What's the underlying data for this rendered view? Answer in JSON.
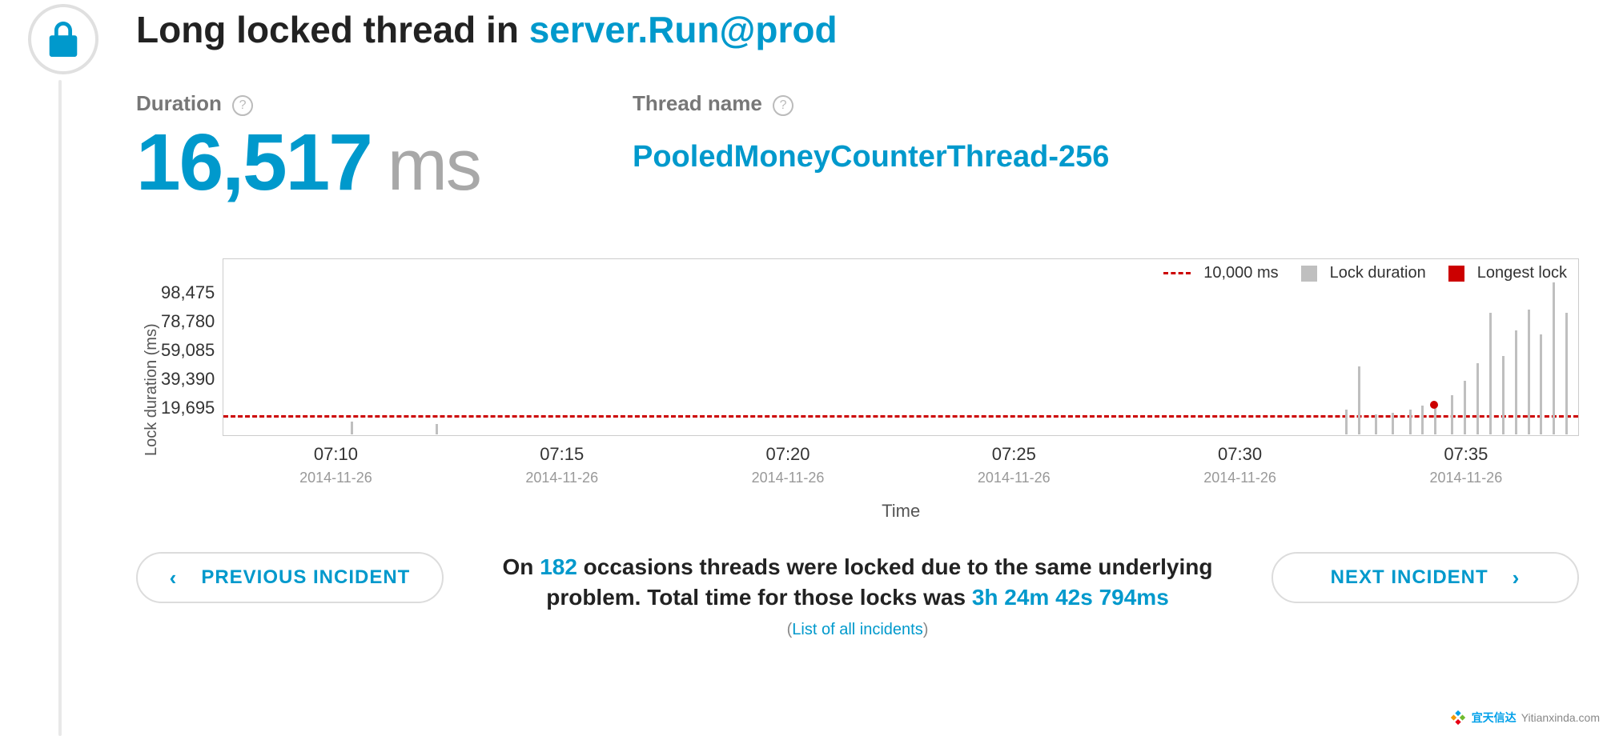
{
  "title_prefix": "Long locked thread in ",
  "title_accent": "server.Run@prod",
  "duration": {
    "label": "Duration",
    "value": "16,517",
    "unit": "ms"
  },
  "thread": {
    "label": "Thread name",
    "value": "PooledMoneyCounterThread-256"
  },
  "nav": {
    "prev": "PREVIOUS INCIDENT",
    "next": "NEXT INCIDENT"
  },
  "summary": {
    "p1a": "On ",
    "occasions": "182",
    "p1b": " occasions threads were locked due to the same underlying problem. Total time for those locks was ",
    "total": "3h 24m 42s 794ms",
    "list_prefix": "(",
    "list_link": "List of all incidents",
    "list_suffix": ")"
  },
  "watermark": {
    "brand_cn": "宜天信达",
    "domain": "Yitianxinda.com"
  },
  "chart_data": {
    "type": "bar",
    "ylabel": "Lock duration (ms)",
    "xlabel": "Time",
    "ylim": [
      0,
      98475
    ],
    "yticks": [
      98475,
      78780,
      59085,
      39390,
      19695
    ],
    "threshold": {
      "label": "10,000 ms",
      "value": 10000
    },
    "x_range_minutes": [
      427,
      459
    ],
    "xticks": [
      {
        "time": "07:10",
        "date": "2014-11-26",
        "minute": 430
      },
      {
        "time": "07:15",
        "date": "2014-11-26",
        "minute": 435
      },
      {
        "time": "07:20",
        "date": "2014-11-26",
        "minute": 440
      },
      {
        "time": "07:25",
        "date": "2014-11-26",
        "minute": 445
      },
      {
        "time": "07:30",
        "date": "2014-11-26",
        "minute": 450
      },
      {
        "time": "07:35",
        "date": "2014-11-26",
        "minute": 455
      }
    ],
    "legend": {
      "threshold": "10,000 ms",
      "bars": "Lock duration",
      "marker": "Longest lock"
    },
    "series": [
      {
        "name": "Lock duration",
        "points": [
          {
            "minute": 430.0,
            "value": 7000
          },
          {
            "minute": 432.0,
            "value": 6000
          },
          {
            "minute": 453.5,
            "value": 14000
          },
          {
            "minute": 453.8,
            "value": 38000
          },
          {
            "minute": 454.2,
            "value": 11000
          },
          {
            "minute": 454.6,
            "value": 12000
          },
          {
            "minute": 455.0,
            "value": 14000
          },
          {
            "minute": 455.3,
            "value": 16000
          },
          {
            "minute": 455.6,
            "value": 16517
          },
          {
            "minute": 456.0,
            "value": 22000
          },
          {
            "minute": 456.3,
            "value": 30000
          },
          {
            "minute": 456.6,
            "value": 40000
          },
          {
            "minute": 456.9,
            "value": 68000
          },
          {
            "minute": 457.2,
            "value": 44000
          },
          {
            "minute": 457.5,
            "value": 58000
          },
          {
            "minute": 457.8,
            "value": 70000
          },
          {
            "minute": 458.1,
            "value": 56000
          },
          {
            "minute": 458.4,
            "value": 85000
          },
          {
            "minute": 458.7,
            "value": 68000
          }
        ]
      }
    ],
    "longest_lock": {
      "minute": 455.6,
      "value": 16517
    }
  }
}
